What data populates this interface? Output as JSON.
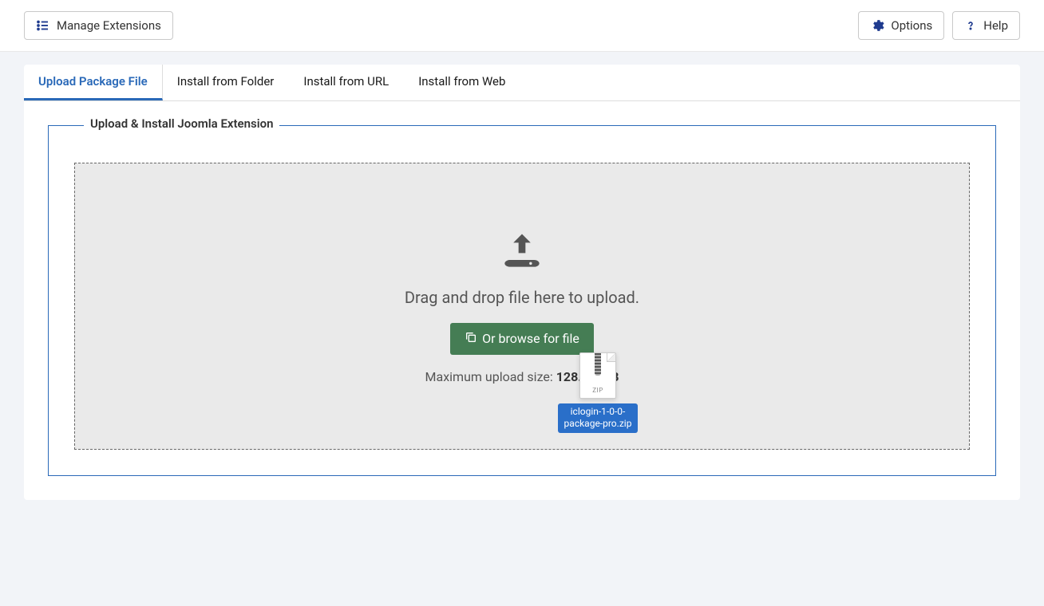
{
  "toolbar": {
    "manage_extensions": "Manage Extensions",
    "options": "Options",
    "help": "Help"
  },
  "tabs": [
    {
      "label": "Upload Package File",
      "active": true
    },
    {
      "label": "Install from Folder",
      "active": false
    },
    {
      "label": "Install from URL",
      "active": false
    },
    {
      "label": "Install from Web",
      "active": false
    }
  ],
  "upload": {
    "fieldset_title": "Upload & Install Joomla Extension",
    "drop_text": "Drag and drop file here to upload.",
    "browse_label": "Or browse for file",
    "max_size_label": "Maximum upload size: ",
    "max_size_value": "128.00 MB"
  },
  "dragged_file": {
    "type": "ZIP",
    "name": "iclogin-1-0-0-package-pro.zip"
  }
}
